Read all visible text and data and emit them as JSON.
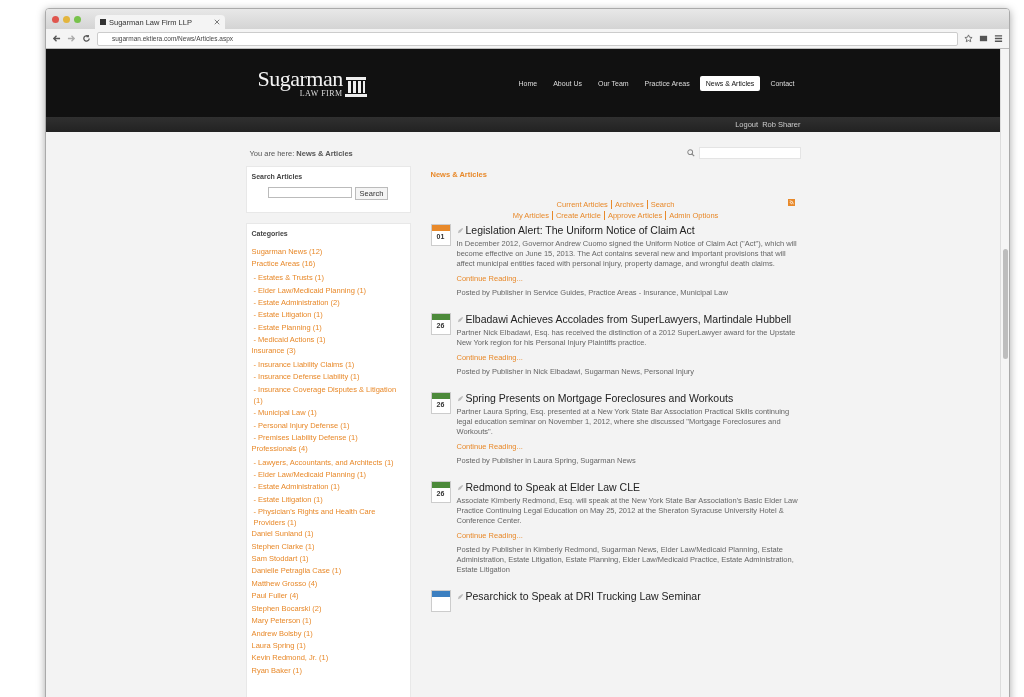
{
  "browser": {
    "tab_title": "Sugarman Law Firm LLP",
    "url": "sugarman.ektiera.com/News/Articles.aspx"
  },
  "site": {
    "logo_main": "Sugarman",
    "logo_sub": "LAW FIRM",
    "nav": [
      {
        "label": "Home",
        "selected": false
      },
      {
        "label": "About Us",
        "selected": false
      },
      {
        "label": "Our Team",
        "selected": false
      },
      {
        "label": "Practice Areas",
        "selected": false
      },
      {
        "label": "News & Articles",
        "selected": true
      },
      {
        "label": "Contact",
        "selected": false
      }
    ],
    "login": {
      "link": "Logout",
      "user": "Rob Sharer"
    }
  },
  "breadcrumb": "You are here: **News & Articles**",
  "sidebar": {
    "search_title": "Search Articles",
    "search_button": "Search",
    "categories_title": "Categories",
    "categories": [
      {
        "label": "Sugarman News (12)"
      },
      {
        "label": "Practice Areas (16)",
        "children": [
          {
            "label": "- Estates & Trusts (1)"
          },
          {
            "label": "- Elder Law/Medicaid Planning (1)"
          },
          {
            "label": "- Estate Administration (2)"
          },
          {
            "label": "- Estate Litigation (1)"
          },
          {
            "label": "- Estate Planning (1)"
          },
          {
            "label": "- Medicaid Actions (1)"
          }
        ]
      },
      {
        "label": "Insurance (3)",
        "children": [
          {
            "label": "- Insurance Liability Claims (1)"
          },
          {
            "label": "- Insurance Defense Liability (1)"
          },
          {
            "label": "- Insurance Coverage Disputes & Litigation (1)"
          },
          {
            "label": "- Municipal Law (1)"
          },
          {
            "label": "- Personal Injury Defense (1)"
          },
          {
            "label": "- Premises Liability Defense (1)"
          }
        ]
      },
      {
        "label": "Professionals (4)",
        "children": [
          {
            "label": "- Lawyers, Accountants, and Architects (1)"
          },
          {
            "label": "- Elder Law/Medicaid Planning (1)"
          },
          {
            "label": "- Estate Administration (1)"
          },
          {
            "label": "- Estate Litigation (1)"
          },
          {
            "label": "- Physician's Rights and Health Care Providers (1)"
          }
        ]
      },
      {
        "label": "Daniel Sunland (1)"
      },
      {
        "label": "Stephen Clarke (1)"
      },
      {
        "label": "Sam Stoddart (1)"
      },
      {
        "label": "Danielle Petraglia Case (1)"
      },
      {
        "label": "Matthew Grosso (4)"
      },
      {
        "label": "Paul Fuller (4)"
      },
      {
        "label": "Stephen Bocarski (2)"
      },
      {
        "label": "Mary Peterson (1)"
      },
      {
        "label": "Andrew Bolsby (1)"
      },
      {
        "label": "Laura Spring (1)"
      },
      {
        "label": "Kevin Redmond, Jr. (1)"
      },
      {
        "label": "Ryan Baker (1)"
      }
    ]
  },
  "main": {
    "title": "News & Articles",
    "links_row_1": [
      "Current Articles",
      "Archives",
      "Search"
    ],
    "links_row_2": [
      "My Articles",
      "Create Article",
      "Approve Articles",
      "Admin Options"
    ],
    "articles": [
      {
        "day": "01",
        "color": "#e8892a",
        "title": "Legislation Alert: The Uniform Notice of Claim Act",
        "summary": "In December 2012, Governor Andrew Cuomo signed the Uniform Notice of Claim Act (\"Act\"), which will become effective on June 15, 2013. The Act contains several new and important provisions that will affect municipal entities faced with personal injury, property damage, and wrongful death claims.",
        "more": "Continue Reading...",
        "meta": "Posted by Publisher in Service Guides, Practice Areas - Insurance, Municipal Law"
      },
      {
        "day": "26",
        "color": "#4c8a3a",
        "title": "Elbadawi Achieves Accolades from SuperLawyers, Martindale Hubbell",
        "summary": "Partner Nick Elbadawi, Esq. has received the distinction of a 2012 SuperLawyer award for the Upstate New York region for his Personal Injury Plaintiffs practice.",
        "more": "Continue Reading...",
        "meta": "Posted by Publisher in Nick Elbadawi, Sugarman News, Personal Injury"
      },
      {
        "day": "26",
        "color": "#4c8a3a",
        "title": "Spring Presents on Mortgage Foreclosures and Workouts",
        "summary": "Partner Laura Spring, Esq. presented at a New York State Bar Association Practical Skills continuing legal education seminar on November 1, 2012, where she discussed \"Mortgage Foreclosures and Workouts\".",
        "more": "Continue Reading...",
        "meta": "Posted by Publisher in Laura Spring, Sugarman News"
      },
      {
        "day": "26",
        "color": "#4c8a3a",
        "title": "Redmond to Speak at Elder Law CLE",
        "summary": "Associate Kimberly Redmond, Esq. will speak at the New York State Bar Association's Basic Elder Law Practice Continuing Legal Education on May 25, 2012 at the Sheraton Syracuse University Hotel & Conference Center.",
        "more": "Continue Reading...",
        "meta": "Posted by Publisher in Kimberly Redmond, Sugarman News, Elder Law/Medicaid Planning, Estate Administration, Estate Litigation, Estate Planning, Elder Law/Medicaid Practice, Estate Administration, Estate Litigation"
      },
      {
        "color": "#3c7fc0",
        "title": "Pesarchick to Speak at DRI Trucking Law Seminar"
      }
    ]
  }
}
